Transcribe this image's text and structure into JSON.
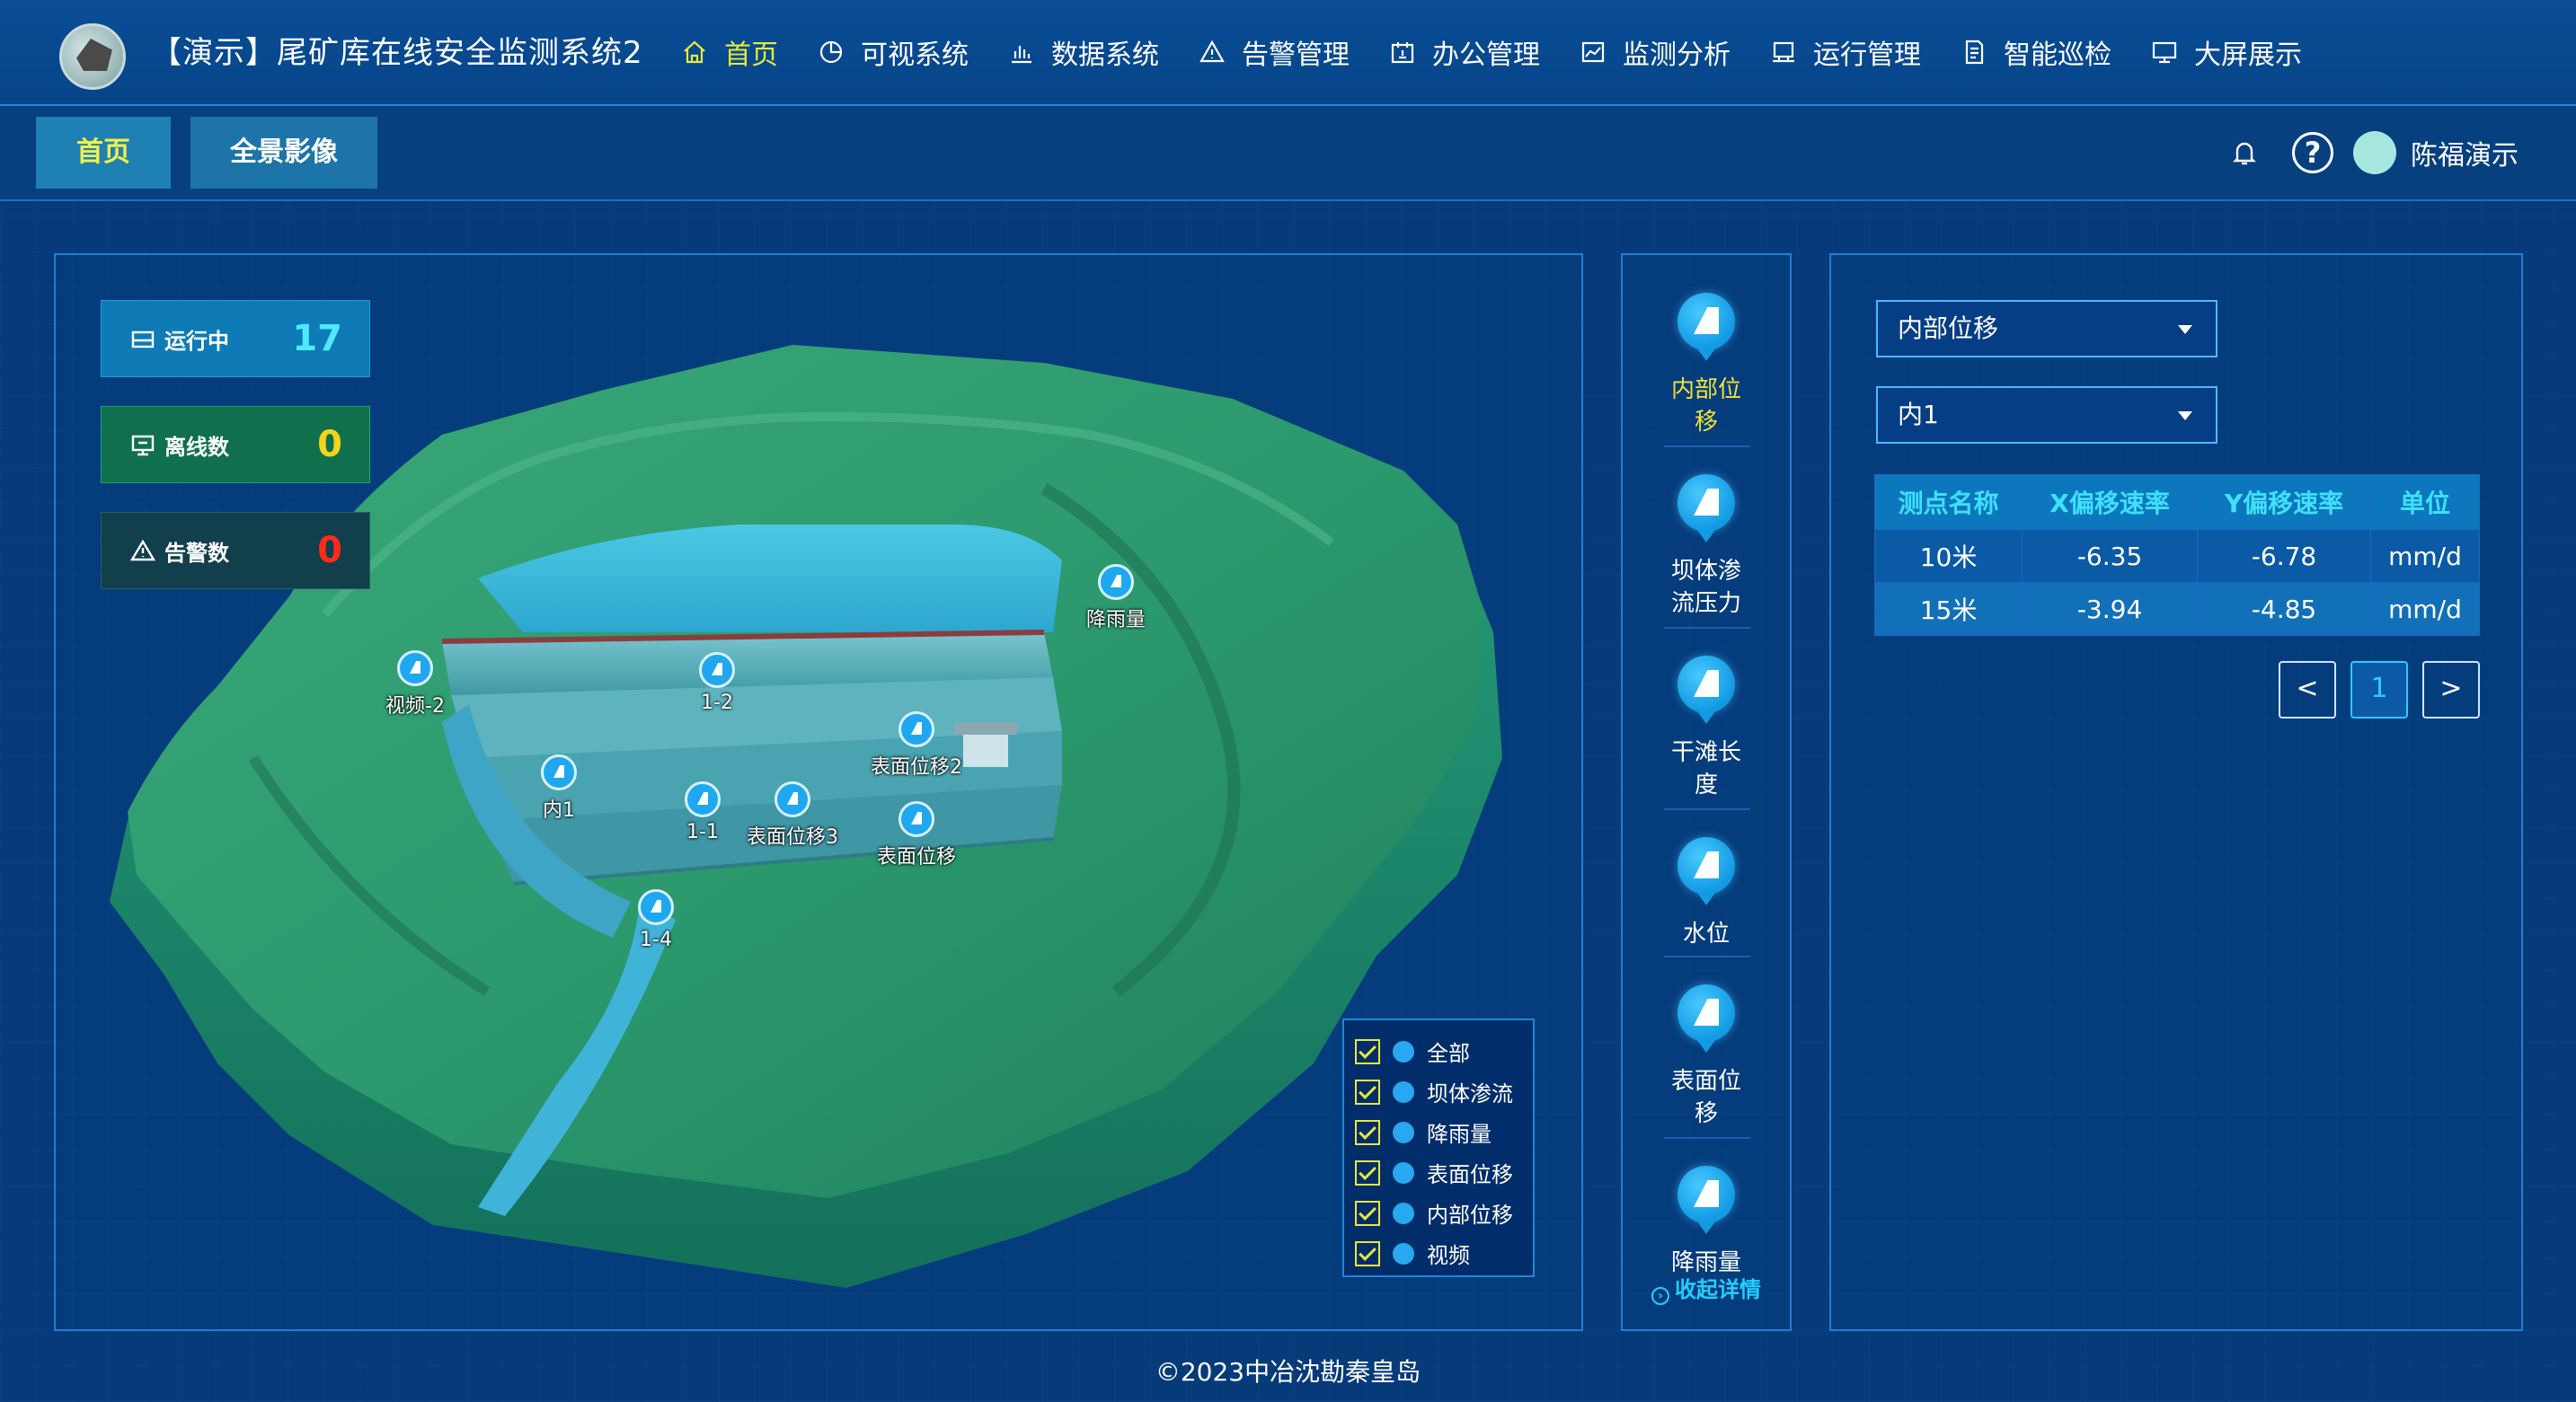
{
  "header": {
    "title": "【演示】尾矿库在线安全监测系统2",
    "nav": [
      {
        "label": "首页",
        "icon": "home-icon",
        "active": true
      },
      {
        "label": "可视系统",
        "icon": "pie-chart-icon",
        "active": false
      },
      {
        "label": "数据系统",
        "icon": "bar-chart-icon",
        "active": false
      },
      {
        "label": "告警管理",
        "icon": "warning-icon",
        "active": false
      },
      {
        "label": "办公管理",
        "icon": "calendar-icon",
        "active": false
      },
      {
        "label": "监测分析",
        "icon": "line-chart-icon",
        "active": false
      },
      {
        "label": "运行管理",
        "icon": "monitor-icon",
        "active": false
      },
      {
        "label": "智能巡检",
        "icon": "document-icon",
        "active": false
      },
      {
        "label": "大屏展示",
        "icon": "display-icon",
        "active": false
      }
    ]
  },
  "subbar": {
    "tabs": [
      {
        "label": "首页",
        "active": true
      },
      {
        "label": "全景影像",
        "active": false
      }
    ],
    "user": {
      "name": "陈福演示",
      "help": "?"
    }
  },
  "status": {
    "running": {
      "label": "运行中",
      "value": "17"
    },
    "offline": {
      "label": "离线数",
      "value": "0"
    },
    "alarm": {
      "label": "告警数",
      "value": "0"
    }
  },
  "markers": [
    {
      "label": "视频-2"
    },
    {
      "label": "1-2"
    },
    {
      "label": "降雨量"
    },
    {
      "label": "表面位移2"
    },
    {
      "label": "内1"
    },
    {
      "label": "1-1"
    },
    {
      "label": "表面位移3"
    },
    {
      "label": "表面位移"
    },
    {
      "label": "1-4"
    }
  ],
  "legend": [
    {
      "label": "全部",
      "checked": true
    },
    {
      "label": "坝体渗流",
      "checked": true
    },
    {
      "label": "降雨量",
      "checked": true
    },
    {
      "label": "表面位移",
      "checked": true
    },
    {
      "label": "内部位移",
      "checked": true
    },
    {
      "label": "视频",
      "checked": true
    }
  ],
  "types": [
    {
      "label": "内部位移",
      "active": true
    },
    {
      "label": "坝体渗流压力",
      "active": false
    },
    {
      "label": "干滩长度",
      "active": false
    },
    {
      "label": "水位",
      "active": false
    },
    {
      "label": "表面位移",
      "active": false
    },
    {
      "label": "降雨量",
      "active": false
    }
  ],
  "collapse_label": "收起详情",
  "data_panel": {
    "select_type": "内部位移",
    "select_point": "内1",
    "table": {
      "headers": [
        "测点名称",
        "X偏移速率",
        "Y偏移速率",
        "单位"
      ],
      "rows": [
        [
          "10米",
          "-6.35",
          "-6.78",
          "mm/d"
        ],
        [
          "15米",
          "-3.94",
          "-4.85",
          "mm/d"
        ]
      ]
    },
    "pager": {
      "prev": "<",
      "page": "1",
      "next": ">"
    }
  },
  "footer": "©2023中冶沈勘秦皇岛",
  "colors": {
    "background": "#063a78",
    "accent_yellow": "#e8ea3a",
    "table_header_text": "#3fe0ff",
    "running": "#4fe9ff",
    "offline": "#f3d41a",
    "alarm": "#ff2a1a"
  }
}
